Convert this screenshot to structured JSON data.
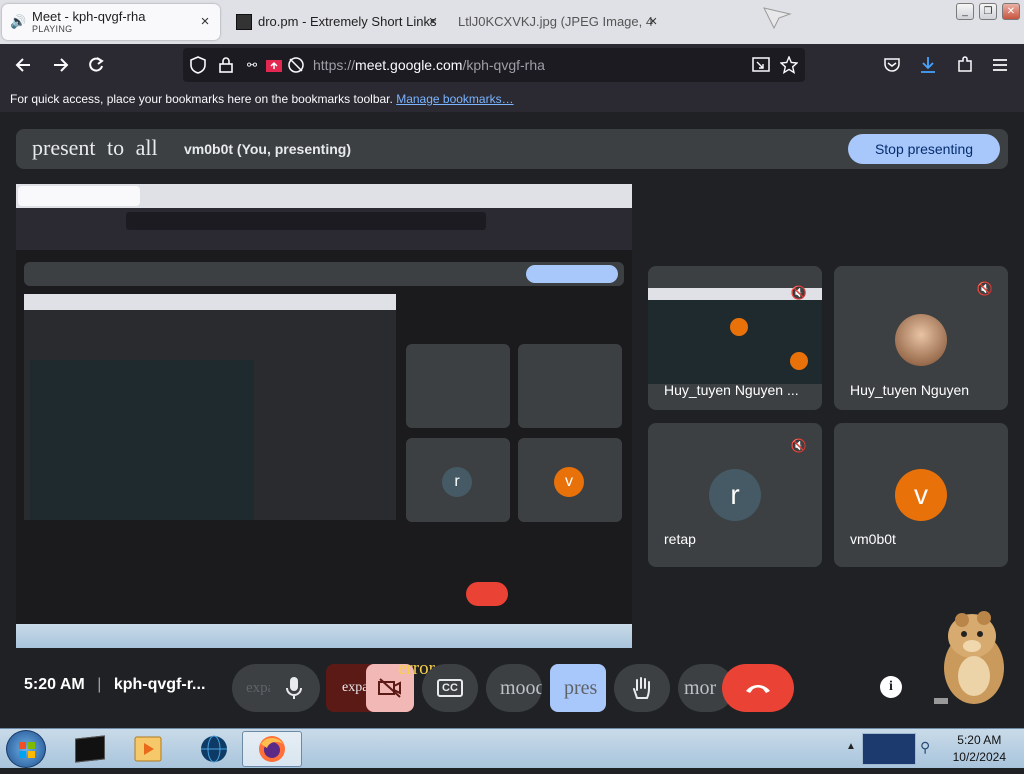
{
  "tabs": [
    {
      "title": "Meet - kph-qvgf-rha",
      "subtitle": "PLAYING",
      "close": "×"
    },
    {
      "title": "dro.pm - Extremely Short Links",
      "close": "×"
    },
    {
      "title": "LtlJ0KCXVKJ.jpg (JPEG Image, 4",
      "close": "×"
    }
  ],
  "window_buttons": [
    "_",
    "❐",
    "✕"
  ],
  "url": {
    "prefix": "https://",
    "host": "meet.google.com",
    "path": "/kph-qvgf-rha"
  },
  "bookmarks_bar": {
    "text": "For quick access, place your bookmarks here on the bookmarks toolbar.",
    "link": "Manage bookmarks…"
  },
  "present_bar": {
    "title": "present to all",
    "presenter": "vm0b0t (You, presenting)",
    "stop_button": "Stop presenting"
  },
  "participants": [
    {
      "name": "Huy_tuyen Nguyen ...",
      "type": "screen"
    },
    {
      "name": "Huy_tuyen Nguyen",
      "type": "photo"
    },
    {
      "name": "retap",
      "initial": "r",
      "avatar_color": "#455a64"
    },
    {
      "name": "vm0b0t",
      "initial": "v",
      "avatar_color": "#e8710a"
    }
  ],
  "controls": {
    "time": "5:20 AM",
    "meeting_code": "kph-qvgf-r...",
    "expand_label": "expa",
    "expand2_label": "expand ca",
    "error_label": "error",
    "mood_label": "mood",
    "present_label": "pres",
    "more_label": "mor"
  },
  "colors": {
    "stop_button": "#a8c7fa",
    "end_call": "#ea4335",
    "camera_off": "#5c1a17",
    "present_active": "#a8c7fa"
  },
  "taskbar": {
    "time": "5:20 AM",
    "date": "10/2/2024"
  }
}
